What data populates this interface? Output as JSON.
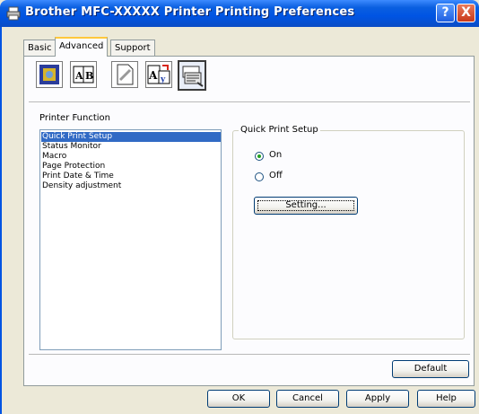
{
  "window": {
    "title": "Brother MFC-XXXXX Printer Printing Preferences",
    "help_button": "?",
    "close_button": "X"
  },
  "tabs": [
    {
      "label": "Basic",
      "active": false
    },
    {
      "label": "Advanced",
      "active": true
    },
    {
      "label": "Support",
      "active": false
    }
  ],
  "toolbar_icons": [
    "print-quality-icon",
    "duplex-icon",
    "watermark-icon",
    "scaling-icon",
    "device-options-icon"
  ],
  "printer_function": {
    "label": "Printer Function",
    "items": [
      "Quick Print Setup",
      "Status Monitor",
      "Macro",
      "Page Protection",
      "Print Date & Time",
      "Density adjustment"
    ],
    "selected": "Quick Print Setup"
  },
  "quick_print_setup": {
    "group_title": "Quick Print Setup",
    "options": [
      "On",
      "Off"
    ],
    "selected": "On",
    "setting_button": "Setting..."
  },
  "buttons": {
    "default": "Default",
    "ok": "OK",
    "cancel": "Cancel",
    "apply": "Apply",
    "help": "Help"
  },
  "colors": {
    "titlebar": "#0054e3",
    "selection": "#316ac5",
    "dialog": "#ece9d8"
  }
}
